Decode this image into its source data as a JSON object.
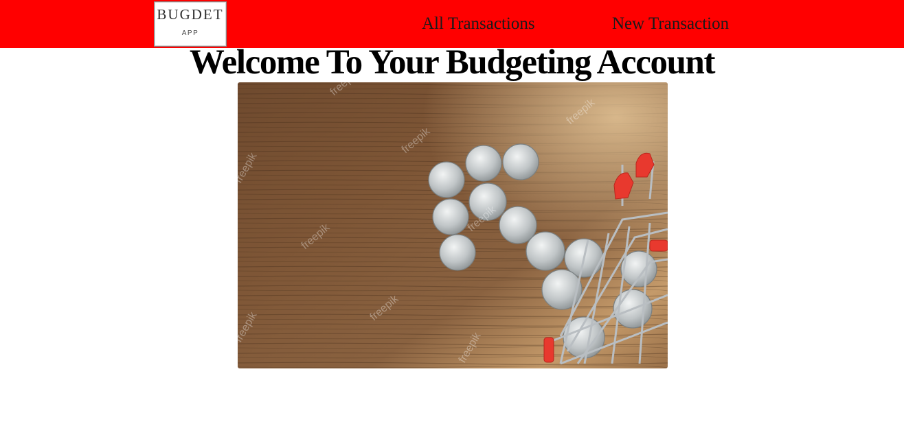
{
  "navbar": {
    "logo": {
      "title": "BUGDET",
      "subtitle": "APP"
    },
    "links": [
      {
        "label": "All Transactions"
      },
      {
        "label": "New Transaction"
      }
    ],
    "background_color": "#ff0000"
  },
  "main": {
    "heading": "Welcome To Your Budgeting Account",
    "hero_image": {
      "watermark": "freepik"
    }
  }
}
